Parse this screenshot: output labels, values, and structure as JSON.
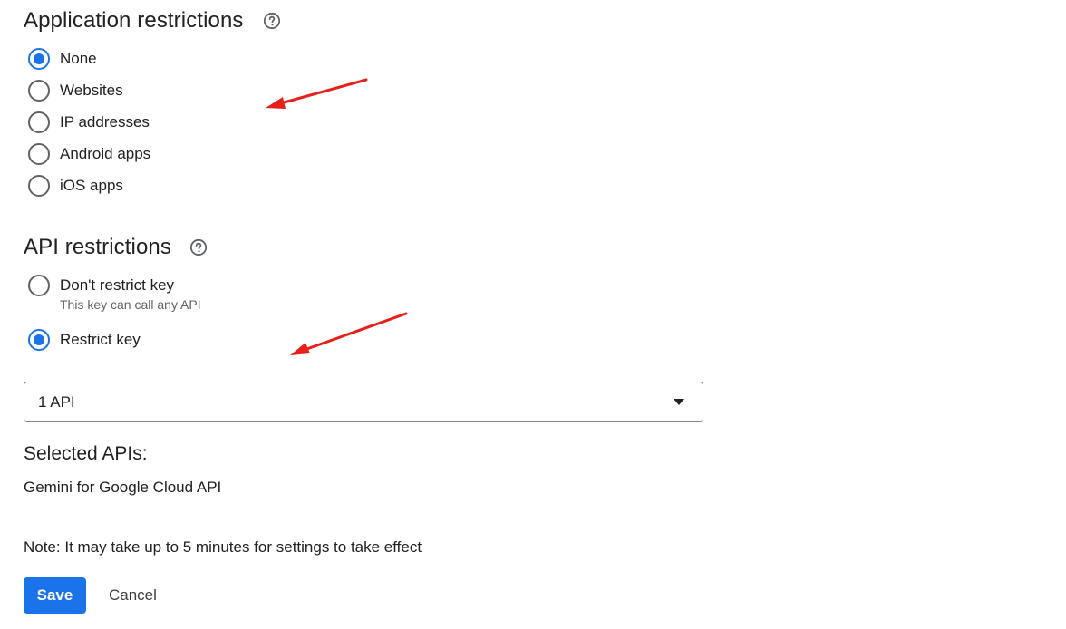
{
  "application_restrictions": {
    "title": "Application restrictions",
    "help_icon": "help-circle-icon",
    "selected": "none",
    "options": [
      {
        "id": "none",
        "label": "None",
        "checked": true
      },
      {
        "id": "websites",
        "label": "Websites",
        "checked": false
      },
      {
        "id": "ip-addresses",
        "label": "IP addresses",
        "checked": false
      },
      {
        "id": "android-apps",
        "label": "Android apps",
        "checked": false
      },
      {
        "id": "ios-apps",
        "label": "iOS apps",
        "checked": false
      }
    ]
  },
  "api_restrictions": {
    "title": "API restrictions",
    "help_icon": "help-circle-icon",
    "selected": "restrict-key",
    "options": [
      {
        "id": "dont-restrict",
        "label": "Don't restrict key",
        "sublabel": "This key can call any API",
        "checked": false
      },
      {
        "id": "restrict-key",
        "label": "Restrict key",
        "checked": true
      }
    ],
    "select": {
      "value": "1 API",
      "icon": "arrow-drop-down-icon"
    }
  },
  "selected_apis": {
    "heading": "Selected APIs:",
    "items": [
      "Gemini for Google Cloud API"
    ]
  },
  "note": "Note: It may take up to 5 minutes for settings to take effect",
  "actions": {
    "save_label": "Save",
    "cancel_label": "Cancel"
  },
  "colors": {
    "accent": "#1a73e8",
    "annotation_arrow": "#e8201b",
    "text": "#202124",
    "muted": "#5f6368"
  }
}
